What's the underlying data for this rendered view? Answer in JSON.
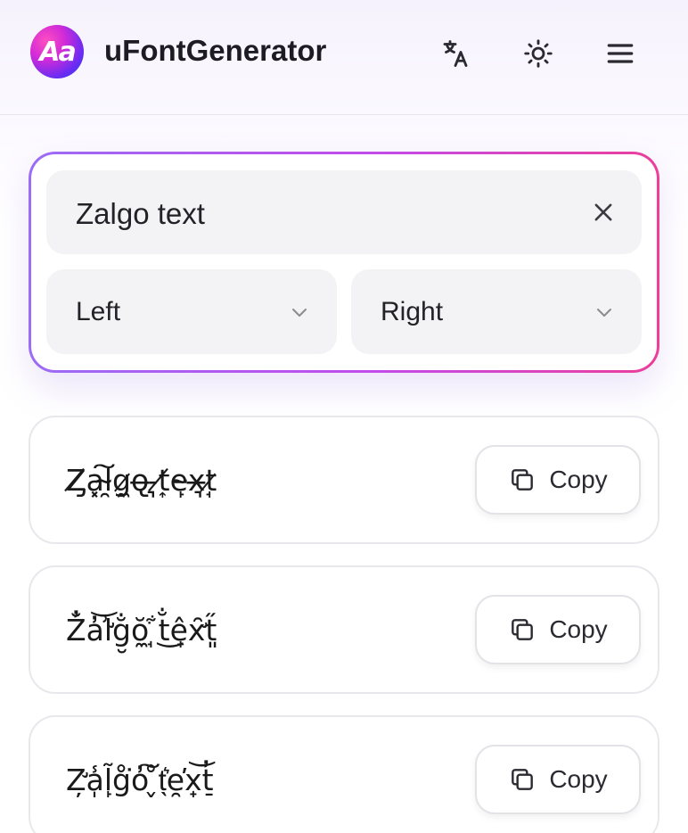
{
  "header": {
    "logo_text": "Aa",
    "brand": "uFontGenerator",
    "icons": [
      "translate-icon",
      "sun-icon",
      "menu-icon"
    ]
  },
  "input": {
    "value": "Zalgo text",
    "left_select": "Left",
    "right_select": "Right"
  },
  "results": [
    {
      "text": "Z̸̡a͓͠l̴̯g̷̼o̶̢ ̵͉t̸͎e̴̙x̶͉t̷̘",
      "copy_label": "Copy"
    },
    {
      "text": "Z̆̓a̓͝l̛͗g̮̐ŏ̼ ̘͋t̐͜ê̟x̛̑t͈̋",
      "copy_label": "Copy"
    },
    {
      "text": "Z̛̦a̩̾l̙̃g̊͘o̓͠ ̬̊t̖͛e̯̕x̟͝t̠̓",
      "copy_label": "Copy"
    }
  ],
  "colors": {
    "accent_start": "#9b6cf6",
    "accent_mid": "#c24be9",
    "accent_end": "#ec3e9a",
    "field_bg": "#f3f3f5"
  }
}
